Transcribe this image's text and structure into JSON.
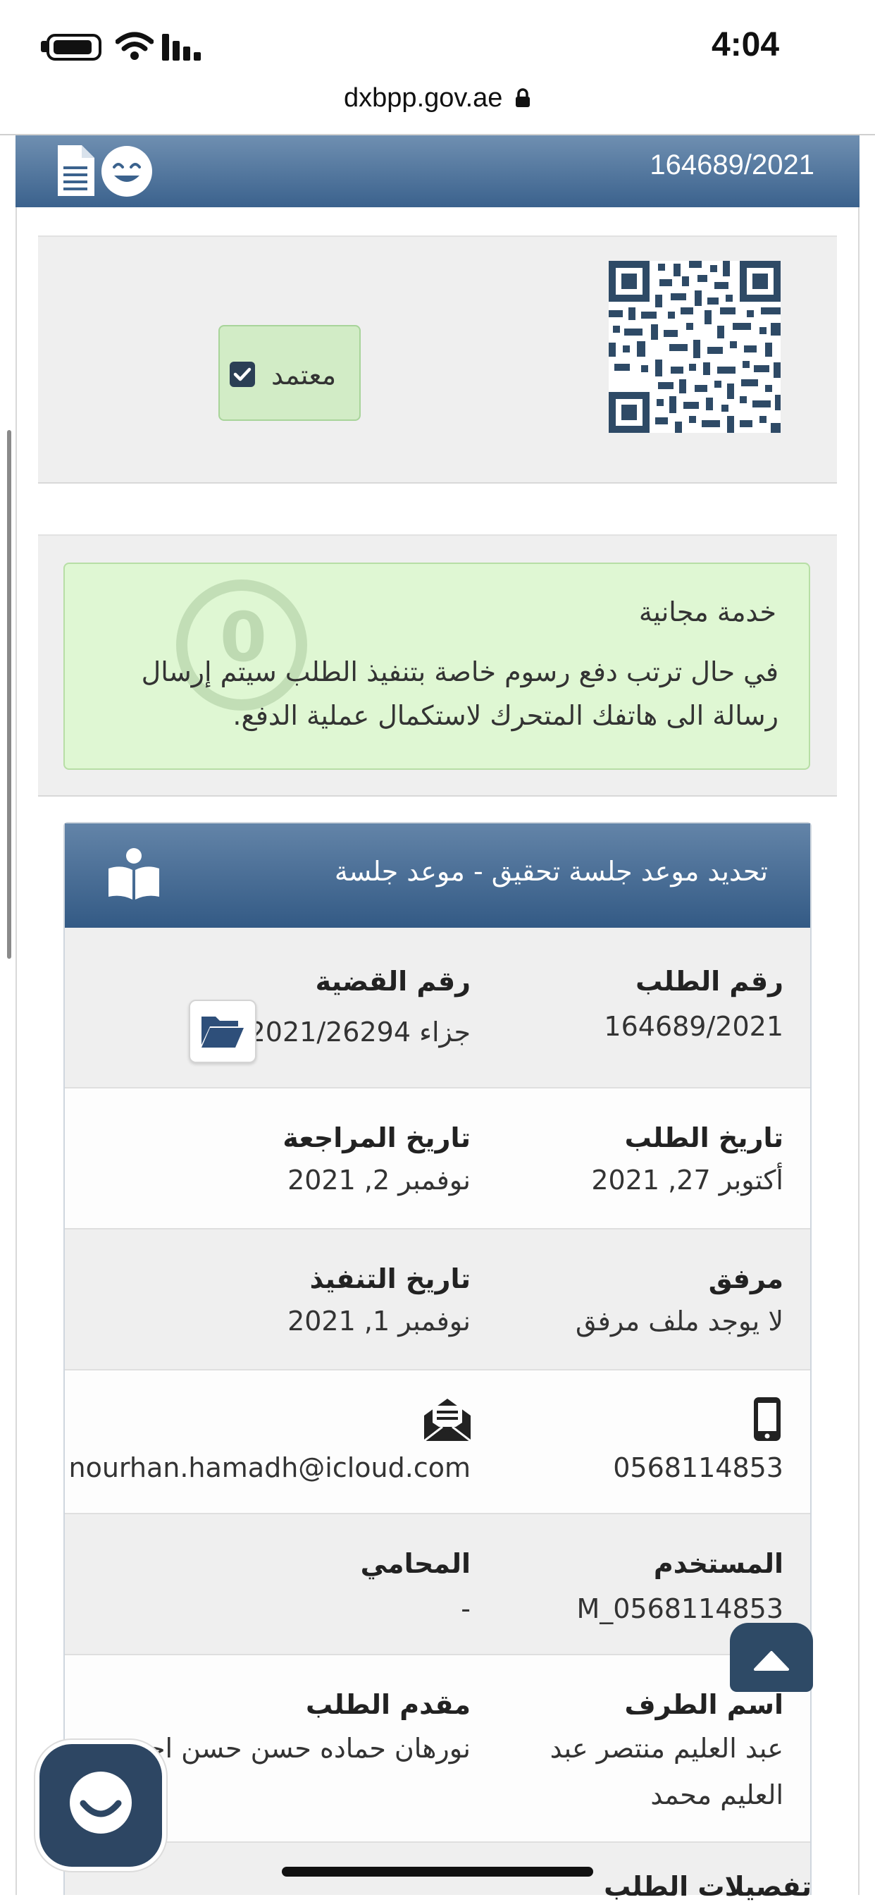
{
  "status_bar": {
    "time": "4:04"
  },
  "browser": {
    "url": "dxbpp.gov.ae"
  },
  "header": {
    "request_number": "164689/2021"
  },
  "approval": {
    "label": "معتمد"
  },
  "notice": {
    "title": "خدمة مجانية",
    "body": "في حال ترتب دفع رسوم خاصة بتنفيذ الطلب سيتم إرسال رسالة الى هاتفك المتحرك لاستكمال عملية الدفع.",
    "watermark": "0"
  },
  "card": {
    "title": "تحديد موعد جلسة تحقيق - موعد جلسة",
    "fields": {
      "request_number": {
        "label": "رقم الطلب",
        "value": "164689/2021"
      },
      "case_number": {
        "label": "رقم القضية",
        "value": "جزاء 2021/26294"
      },
      "request_date": {
        "label": "تاريخ الطلب",
        "value": "أكتوبر 27, 2021"
      },
      "review_date": {
        "label": "تاريخ المراجعة",
        "value": "نوفمبر 2, 2021"
      },
      "attachment": {
        "label": "مرفق",
        "value": "لا يوجد ملف مرفق"
      },
      "execution_date": {
        "label": "تاريخ التنفيذ",
        "value": "نوفمبر 1, 2021"
      },
      "phone": {
        "value": "0568114853"
      },
      "email": {
        "value": "nourhan.hamadh@icloud.com"
      },
      "user": {
        "label": "المستخدم",
        "value": "M_0568114853"
      },
      "lawyer": {
        "label": "المحامي",
        "value": "-"
      },
      "party_name": {
        "label": "اسم الطرف",
        "value_line1": "عبد العليم منتصر عبد",
        "value_line2": "العليم محمد"
      },
      "applicant": {
        "label": "مقدم الطلب",
        "value": "نورهان حماده حسن حسن احمد"
      },
      "next_section": {
        "label": "تفصيلات الطلب"
      }
    }
  },
  "icons": {
    "document": "document-icon",
    "smile": "smile-icon",
    "qr": "qr-code",
    "check": "checkbox-checked-icon",
    "book": "open-book-icon",
    "folder": "folder-open-icon",
    "phone": "mobile-phone-icon",
    "mail": "envelope-open-icon",
    "scroll_top": "caret-up-icon",
    "chat": "chat-smile-icon"
  },
  "colors": {
    "header_blue": "#3b628d",
    "approved_green": "#d2ecc6",
    "notice_green": "#dff7d3",
    "chat_navy": "#2d4663"
  }
}
